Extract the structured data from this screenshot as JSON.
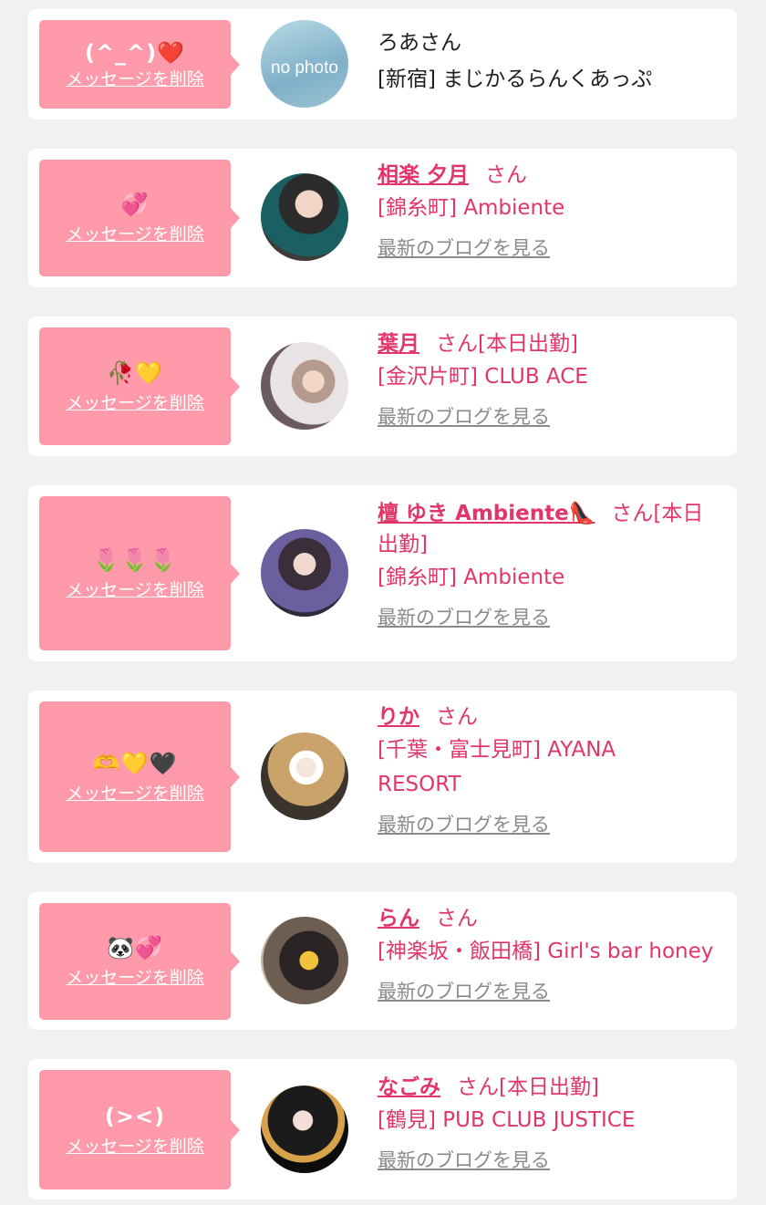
{
  "delete_label": "メッセージを削除",
  "blog_label": "最新のブログを見る",
  "colors": {
    "bubble": "#ff9aab",
    "accent": "#e2356a",
    "muted": "#8a8a8a"
  },
  "items": [
    {
      "emoji": "(^_^)",
      "emoji_extra": "❤️",
      "name": "ろあさん",
      "shop": "[新宿] まじかるらんくあっぷ",
      "avatar_text": "no photo"
    },
    {
      "emoji": "💞",
      "name": "相楽 夕月",
      "san": "さん",
      "shop": "[錦糸町] Ambiente"
    },
    {
      "emoji": "🥀💛",
      "name": "葉月",
      "san": "さん[本日出勤]",
      "shop": "[金沢片町] CLUB ACE"
    },
    {
      "emoji": "🌷🌷🌷",
      "name": "檀 ゆき Ambiente👠",
      "san": "さん[本日",
      "san2": "出勤]",
      "shop": "[錦糸町] Ambiente"
    },
    {
      "emoji": "🫶💛🖤",
      "name": "りか",
      "san": "さん",
      "shop": "[千葉・富士見町] AYANA",
      "shop2": "RESORT"
    },
    {
      "emoji": "🐼💞",
      "name": "らん",
      "san": "さん",
      "shop": "[神楽坂・飯田橋] Girl's bar honey"
    },
    {
      "emoji": "(><)",
      "name": "なごみ",
      "san": "さん[本日出勤]",
      "shop": "[鶴見] PUB CLUB JUSTICE"
    }
  ]
}
